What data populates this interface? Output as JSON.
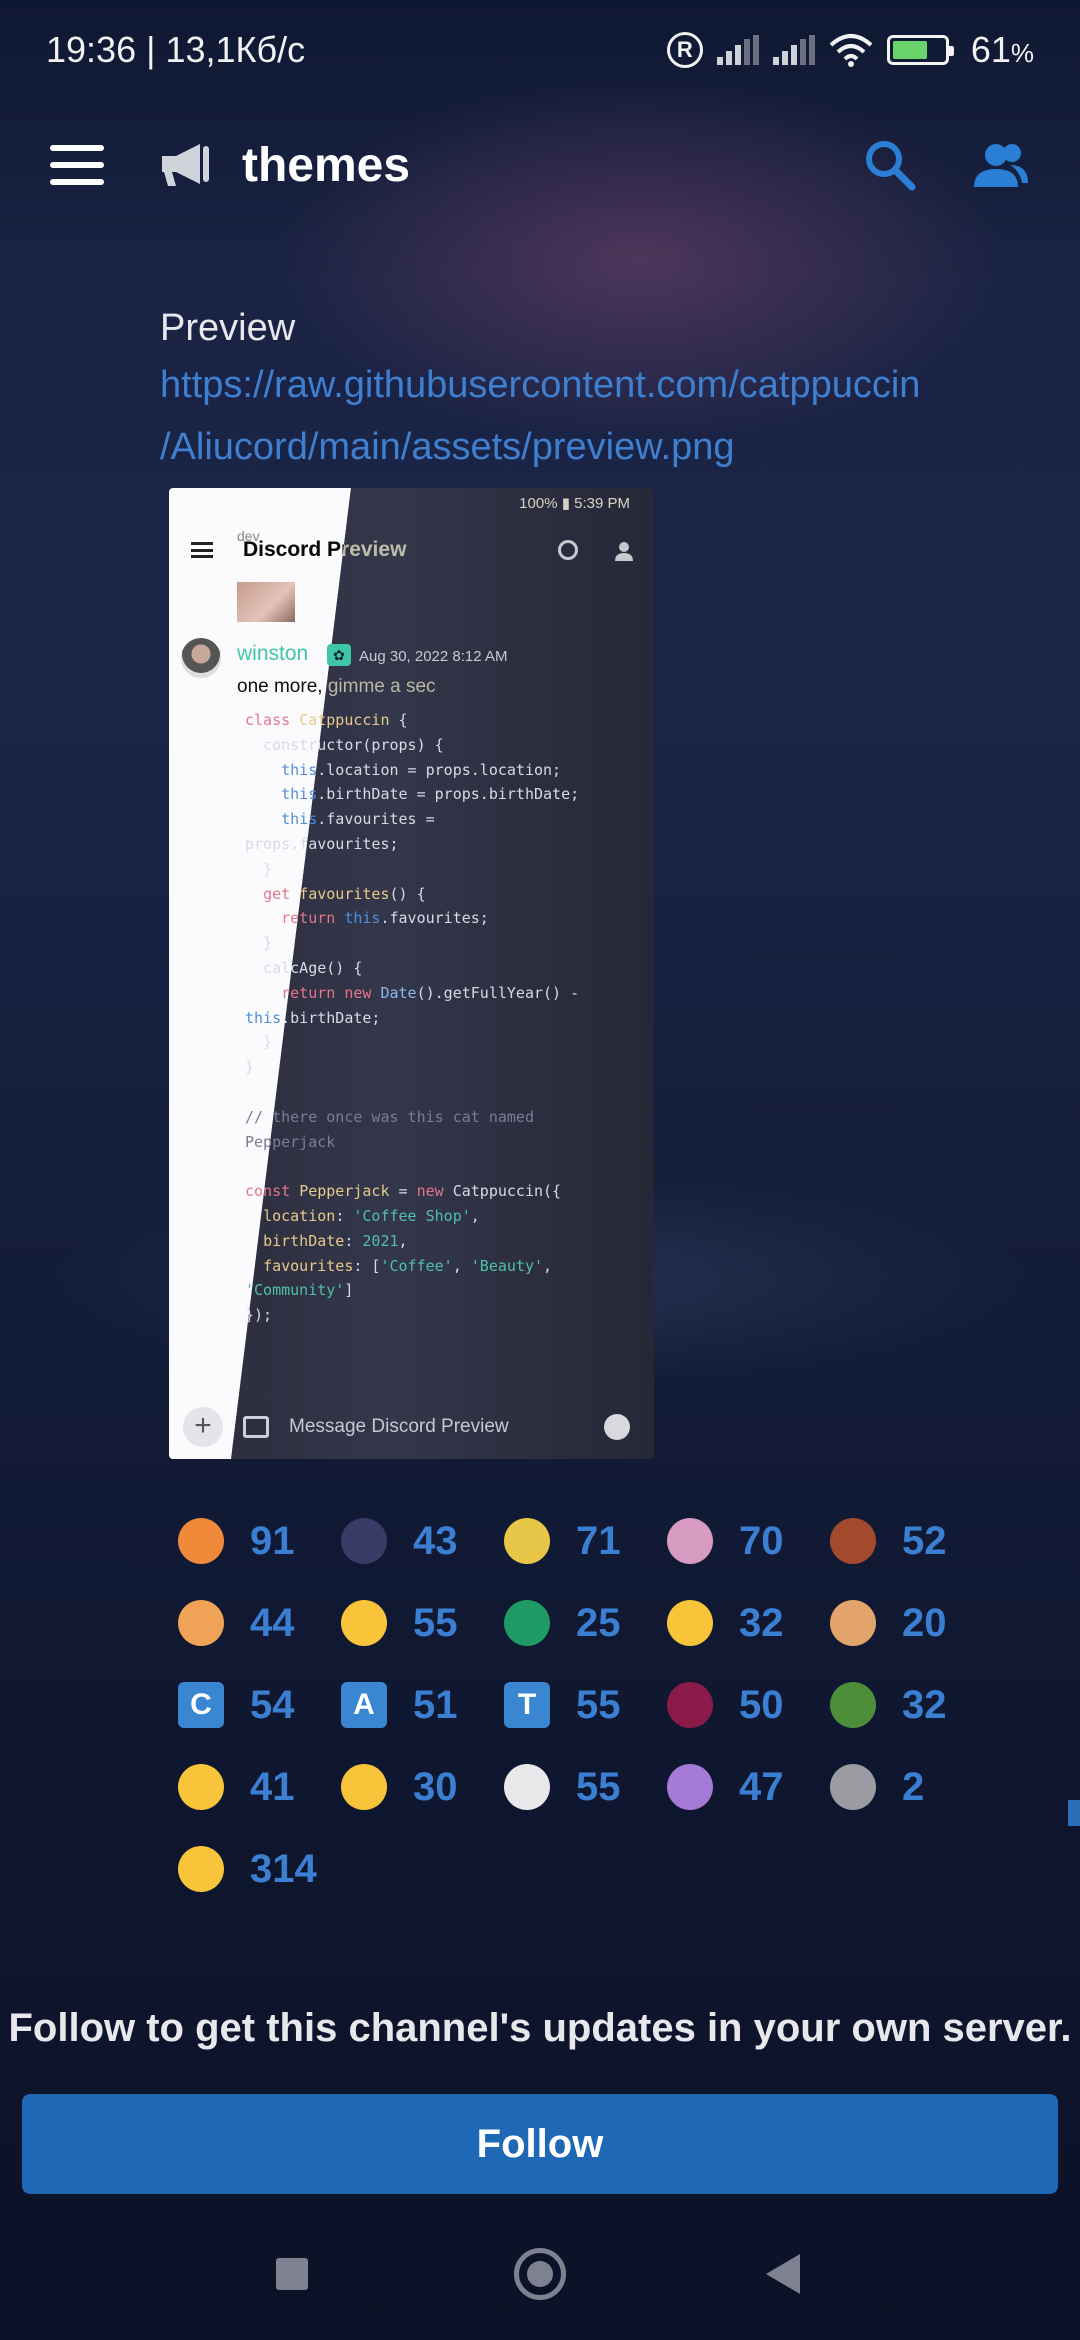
{
  "status_bar": {
    "time": "19:36",
    "speed": "13,1Кб/с",
    "battery": "61",
    "battery_unit": "%",
    "reg_symbol": "R"
  },
  "header": {
    "channel_name": "themes"
  },
  "message": {
    "label": "Preview",
    "link_line1": "https://raw.githubusercontent.com/catppuccin",
    "link_line2": "/Aliucord/main/assets/preview.png"
  },
  "preview_image": {
    "status": "100% ▮ 5:39 PM",
    "title": "Discord Preview",
    "subtitle": "dev",
    "username": "winston",
    "date": "Aug 30, 2022 8:12 AM",
    "text": "one more, gimme a sec",
    "input_placeholder": "Message Discord Preview"
  },
  "reactions": [
    {
      "emoji": "pog-emoji",
      "count": "91",
      "color": "#f08a3a"
    },
    {
      "emoji": "cat-emoji",
      "count": "43",
      "color": "#3a3a66"
    },
    {
      "emoji": "you-tried-star-emoji",
      "count": "71",
      "color": "#e8c648"
    },
    {
      "emoji": "cat-face-emoji",
      "count": "70",
      "color": "#d79ac0"
    },
    {
      "emoji": "face-photo-emoji",
      "count": "52",
      "color": "#a34a2e"
    },
    {
      "emoji": "fox-heart-emoji",
      "count": "44",
      "color": "#f0a356"
    },
    {
      "emoji": "heart-eyes-emoji",
      "count": "55",
      "color": "#f7c43a"
    },
    {
      "emoji": "green-creature-emoji",
      "count": "25",
      "color": "#1f9a64"
    },
    {
      "emoji": "weary-emoji",
      "count": "32",
      "color": "#f7c43a"
    },
    {
      "emoji": "bread-emoji",
      "count": "20",
      "color": "#e2a46a"
    },
    {
      "emoji": "letter-c-emoji",
      "count": "54",
      "color": "#3a86d0",
      "letter": "C"
    },
    {
      "emoji": "letter-a-emoji",
      "count": "51",
      "color": "#3a86d0",
      "letter": "A"
    },
    {
      "emoji": "letter-t-emoji",
      "count": "55",
      "color": "#3a86d0",
      "letter": "T"
    },
    {
      "emoji": "magenta-block-emoji",
      "count": "50",
      "color": "#8a1a4a"
    },
    {
      "emoji": "pepe-yikes-emoji",
      "count": "32",
      "color": "#4e8e3a"
    },
    {
      "emoji": "pensive-emoji",
      "count": "41",
      "color": "#f7c43a"
    },
    {
      "emoji": "raised-eyebrow-emoji",
      "count": "30",
      "color": "#f7c43a"
    },
    {
      "emoji": "skull-emoji",
      "count": "55",
      "color": "#e8e8ea"
    },
    {
      "emoji": "purple-heart-emoji",
      "count": "47",
      "color": "#a57ad6"
    },
    {
      "emoji": "moai-emoji",
      "count": "2",
      "color": "#9a9ca2"
    },
    {
      "emoji": "screaming-emoji",
      "count": "314",
      "color": "#f7c43a"
    }
  ],
  "follow": {
    "prompt": "Follow to get this channel's updates in your own server.",
    "button_label": "Follow"
  }
}
